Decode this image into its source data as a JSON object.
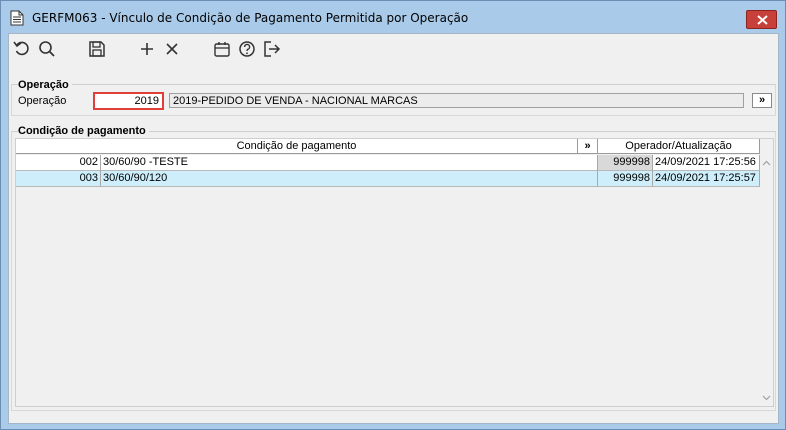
{
  "window": {
    "title": "GERFM063 - Vínculo de Condição de Pagamento Permitida por Operação"
  },
  "toolbar": {
    "icons": [
      "undo-icon",
      "search-icon",
      "save-icon",
      "add-icon",
      "delete-icon",
      "calendar-icon",
      "help-icon",
      "exit-icon"
    ]
  },
  "operacao": {
    "group_title": "Operação",
    "field_label": "Operação",
    "code_value": "2019",
    "description": "2019-PEDIDO DE VENDA - NACIONAL MARCAS",
    "lookup_label": "»"
  },
  "pagamento": {
    "group_title": "Condição de pagamento",
    "columns": {
      "condicao": "Condição de pagamento",
      "expand": "»",
      "operador": "Operador/Atualização"
    },
    "rows": [
      {
        "code": "002",
        "description": "30/60/90 -TESTE",
        "operador": "999998",
        "atualizacao": "24/09/2021 17:25:56"
      },
      {
        "code": "003",
        "description": "30/60/90/120",
        "operador": "999998",
        "atualizacao": "24/09/2021 17:25:57"
      }
    ]
  },
  "colors": {
    "titlebar": "#a9cbe9",
    "close_button": "#c7413a",
    "selected_row": "#cdeefa",
    "required_border": "#e0403a"
  }
}
